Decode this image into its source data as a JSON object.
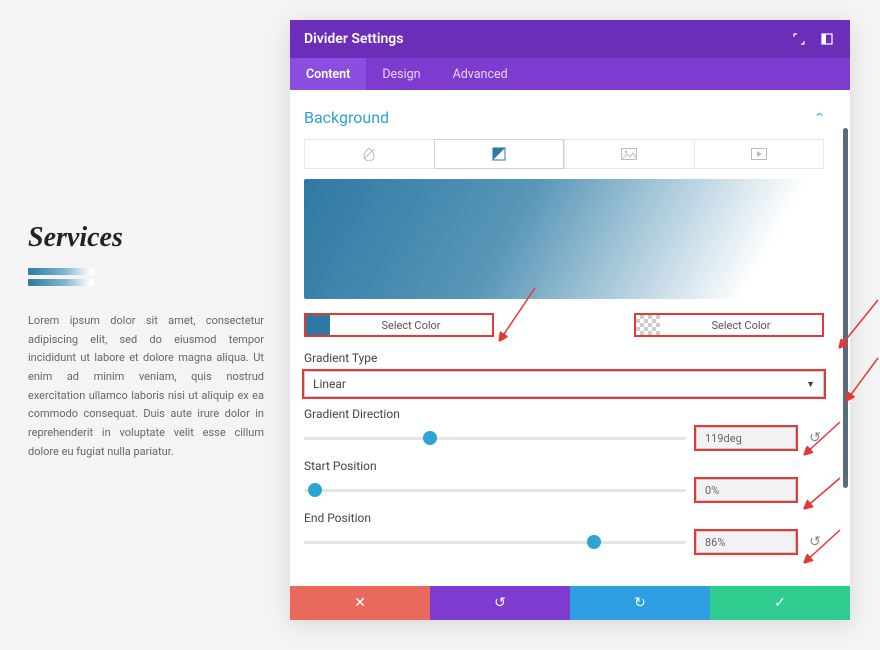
{
  "left": {
    "title": "Services",
    "body": "Lorem ipsum dolor sit amet, consectetur adipiscing elit, sed do eiusmod tempor incididunt ut labore et dolore magna aliqua. Ut enim ad minim veniam, quis nostrud exercitation ullamco laboris nisi ut aliquip ex ea commodo consequat. Duis aute irure dolor in reprehenderit in voluptate velit esse cillum dolore eu fugiat nulla pariatur."
  },
  "modal": {
    "title": "Divider Settings",
    "tabs": {
      "content": "Content",
      "design": "Design",
      "advanced": "Advanced"
    },
    "section_title": "Background",
    "iconTabs": [
      "paint-drop",
      "gradient",
      "image",
      "video"
    ],
    "preview_gradient": {
      "angle": "119deg",
      "color1": "#2e79a3",
      "color2": "#ffffff",
      "start": "0%",
      "end": "86%"
    },
    "color1": {
      "label": "Select Color",
      "value": "#2e79a3"
    },
    "color2": {
      "label": "Select Color",
      "value": "transparent"
    },
    "gradient_type": {
      "label": "Gradient Type",
      "value": "Linear"
    },
    "gradient_direction": {
      "label": "Gradient Direction",
      "value": "119deg",
      "percent": 33
    },
    "start_position": {
      "label": "Start Position",
      "value": "0%",
      "percent": 0
    },
    "end_position": {
      "label": "End Position",
      "value": "86%",
      "percent": 76
    },
    "footer": {
      "cancel": "✕",
      "undo": "↺",
      "redo": "↻",
      "save": "✓"
    }
  }
}
